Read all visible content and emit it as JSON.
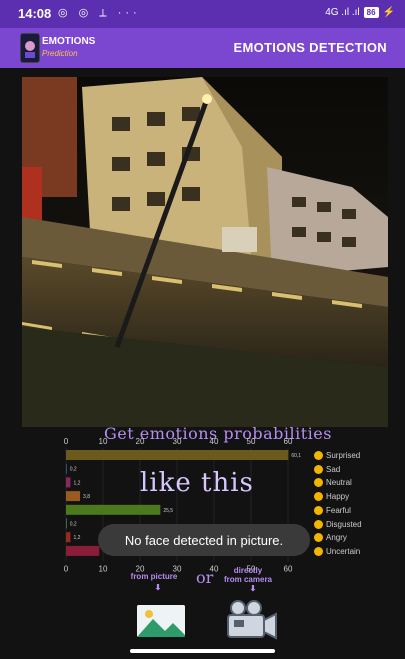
{
  "status": {
    "time": "14:08",
    "left_icons": "◎ ◎ ⟂ ···",
    "signal": "4G .ıl .ıl",
    "battery": "86"
  },
  "app": {
    "title": "EMOTIONS DETECTION",
    "logo_text": "EMOTIONS",
    "logo_sub": "Prediction"
  },
  "promo": {
    "title": "Get emotions probabilities",
    "like_this": "like this",
    "from_picture": "from picture",
    "or": "or",
    "from_camera_1": "directly",
    "from_camera_2": "from camera"
  },
  "toast": {
    "message": "No face detected in picture."
  },
  "chart_data": {
    "type": "bar",
    "orientation": "horizontal",
    "x_ticks": [
      0,
      10,
      20,
      30,
      40,
      50,
      60
    ],
    "xlim": [
      0,
      60
    ],
    "series": [
      {
        "name": "Surprised",
        "value": 60.1,
        "label": "60,1",
        "color": "#6b5a1c"
      },
      {
        "name": "Sad",
        "value": 0.2,
        "label": "0,2",
        "color": "#3a4a7a"
      },
      {
        "name": "Neutral",
        "value": 1.2,
        "label": "1,2",
        "color": "#8a2a5a"
      },
      {
        "name": "Happy",
        "value": 3.8,
        "label": "3,8",
        "color": "#9a5a20"
      },
      {
        "name": "Fearful",
        "value": 25.5,
        "label": "25,5",
        "color": "#4b7a1e"
      },
      {
        "name": "Disgusted",
        "value": 0.2,
        "label": "0,2",
        "color": "#3a6a4a"
      },
      {
        "name": "Angry",
        "value": 1.2,
        "label": "1,2",
        "color": "#9a2a1e"
      },
      {
        "name": "Uncertain",
        "value": 9.0,
        "label": "",
        "color": "#8a1e3a"
      }
    ]
  }
}
